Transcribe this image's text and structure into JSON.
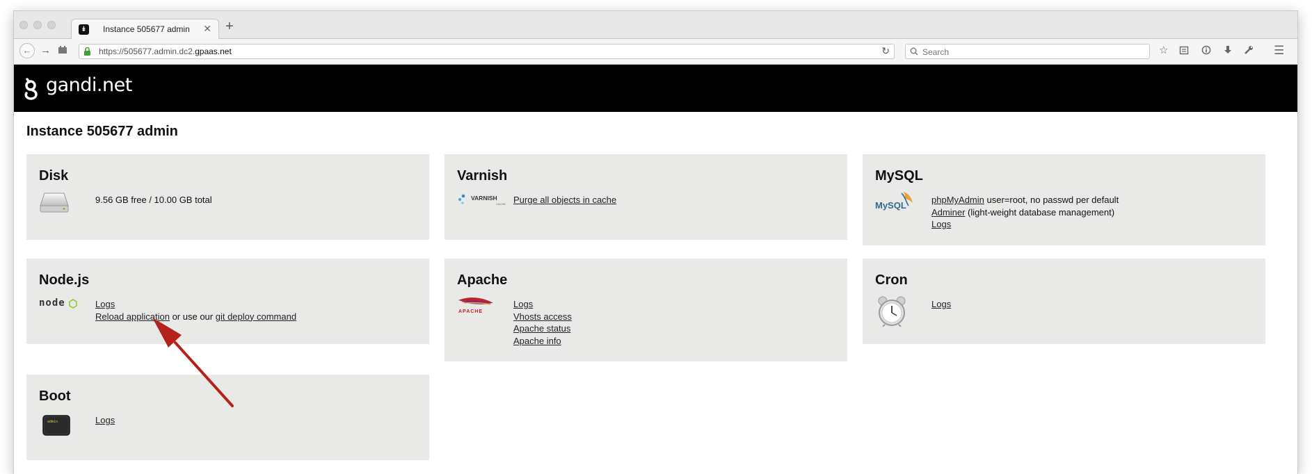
{
  "browser": {
    "tab_title": "Instance 505677 admin",
    "new_tab_label": "+",
    "close_tab_label": "✕",
    "url_prefix": "https://505677.admin.dc2.",
    "url_domain": "gpaas.net",
    "search_placeholder": "Search"
  },
  "header": {
    "logo_text": "gandi.net"
  },
  "page": {
    "title": "Instance 505677 admin"
  },
  "cards": {
    "disk": {
      "title": "Disk",
      "info": "9.56 GB free / 10.00 GB total"
    },
    "varnish": {
      "title": "Varnish",
      "icon_text": "VARNISH",
      "icon_subtext": "CACHE",
      "purge_link": "Purge all objects in cache"
    },
    "mysql": {
      "title": "MySQL",
      "icon_text": "MySQL",
      "phpmyadmin_link": "phpMyAdmin",
      "phpmyadmin_note": " user=root, no passwd per default",
      "adminer_link": "Adminer",
      "adminer_note": " (light-weight database management)",
      "logs_link": "Logs"
    },
    "nodejs": {
      "title": "Node.js",
      "icon_text": "node",
      "logs_link": "Logs",
      "reload_link": "Reload application",
      "middle_text": " or use our ",
      "git_link": "git deploy command"
    },
    "apache": {
      "title": "Apache",
      "icon_text": "APACHE",
      "logs_link": "Logs",
      "vhosts_link": "Vhosts access",
      "status_link": "Apache status",
      "info_link": "Apache info"
    },
    "cron": {
      "title": "Cron",
      "logs_link": "Logs"
    },
    "boot": {
      "title": "Boot",
      "icon_text": "admin",
      "logs_link": "Logs"
    }
  },
  "colors": {
    "card_bg": "#e9e9e7",
    "header_bg": "#000000",
    "arrow": "#b5221b"
  }
}
